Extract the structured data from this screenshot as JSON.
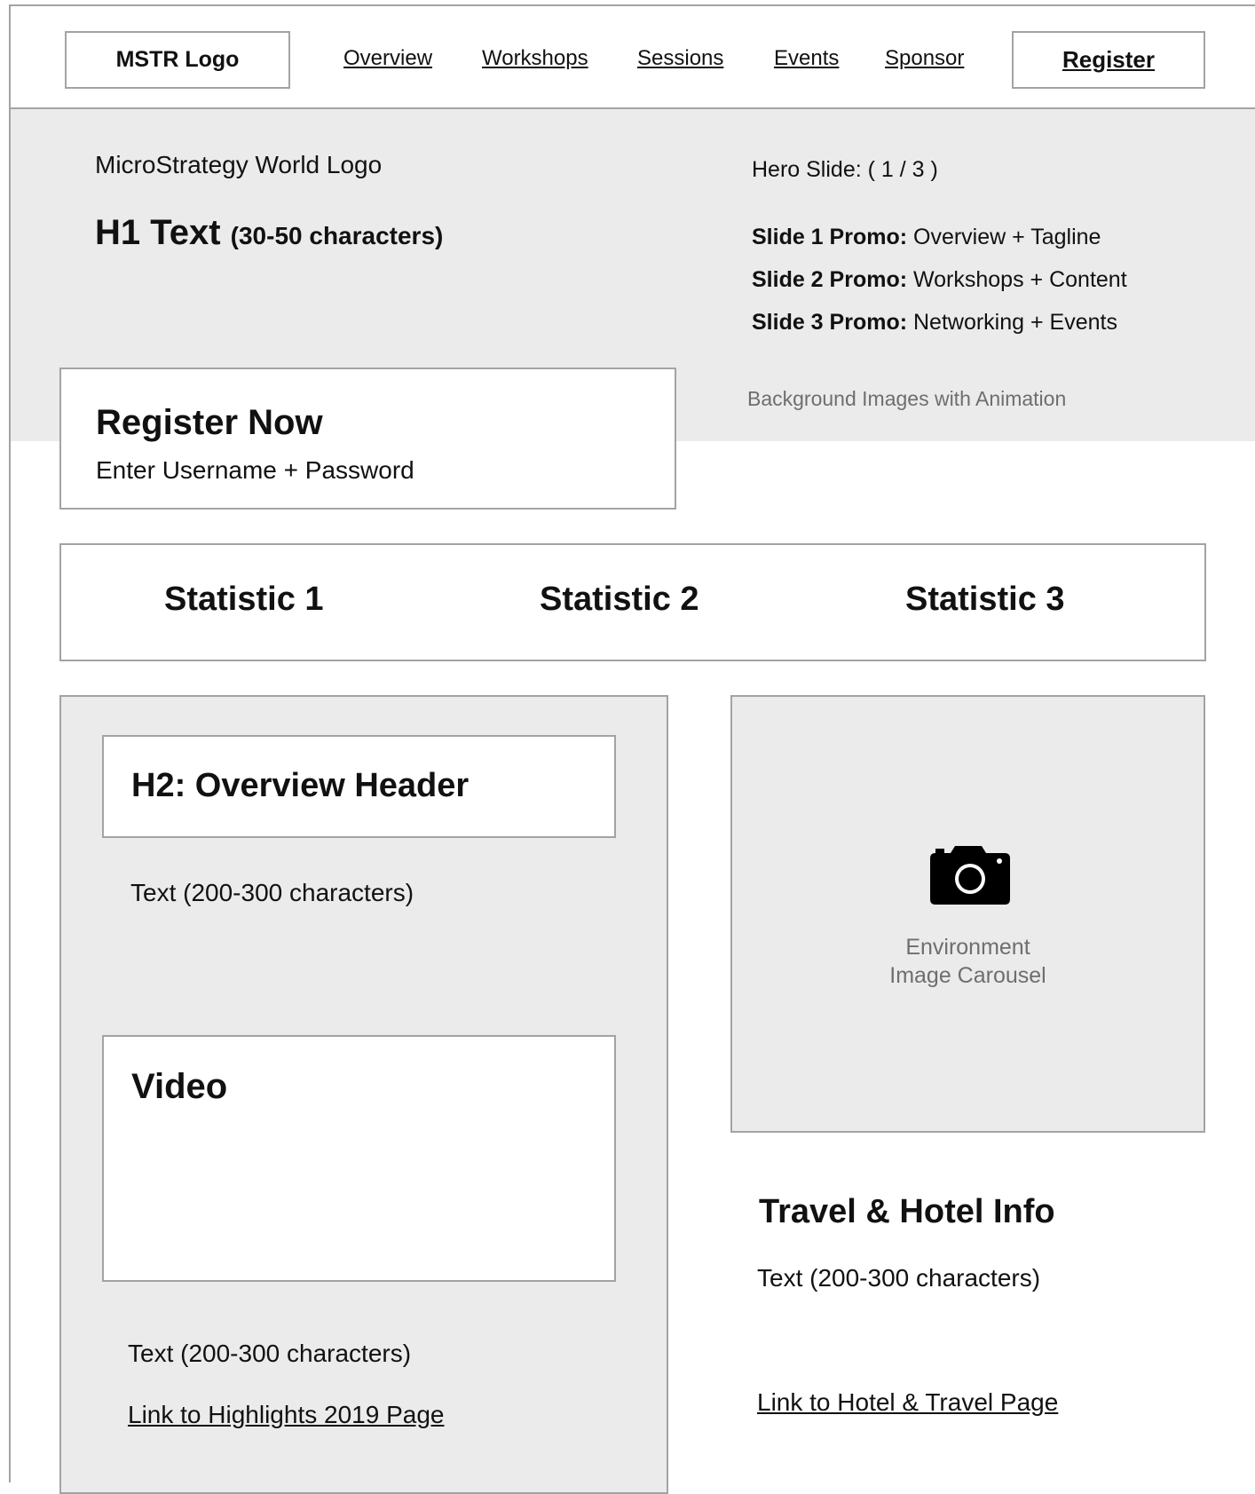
{
  "nav": {
    "logo": "MSTR Logo",
    "links": [
      "Overview",
      "Workshops",
      "Sessions",
      "Events",
      "Sponsor"
    ],
    "register": "Register"
  },
  "hero": {
    "logo_text": "MicroStrategy World Logo",
    "h1": "H1 Text",
    "h1_note": "(30-50 characters)",
    "slide_indicator": "Hero Slide:  ( 1 / 3 )",
    "promos": [
      {
        "label": "Slide 1 Promo:",
        "text": "Overview + Tagline"
      },
      {
        "label": "Slide 2 Promo:",
        "text": "Workshops + Content"
      },
      {
        "label": "Slide 3 Promo:",
        "text": "Networking + Events"
      }
    ],
    "background_note": "Background Images with Animation"
  },
  "register_now": {
    "title": "Register Now",
    "subtitle": "Enter Username + Password"
  },
  "stats": [
    "Statistic 1",
    "Statistic 2",
    "Statistic 3"
  ],
  "overview": {
    "header": "H2: Overview Header",
    "text": "Text (200-300 characters)",
    "video_label": "Video",
    "text_after_video": "Text (200-300 characters)",
    "link": "Link to Highlights 2019 Page"
  },
  "carousel": {
    "icon": "camera-icon",
    "line1": "Environment",
    "line2": "Image Carousel"
  },
  "travel": {
    "title": "Travel & Hotel Info",
    "text": "Text (200-300 characters)",
    "link": "Link to Hotel & Travel Page"
  }
}
